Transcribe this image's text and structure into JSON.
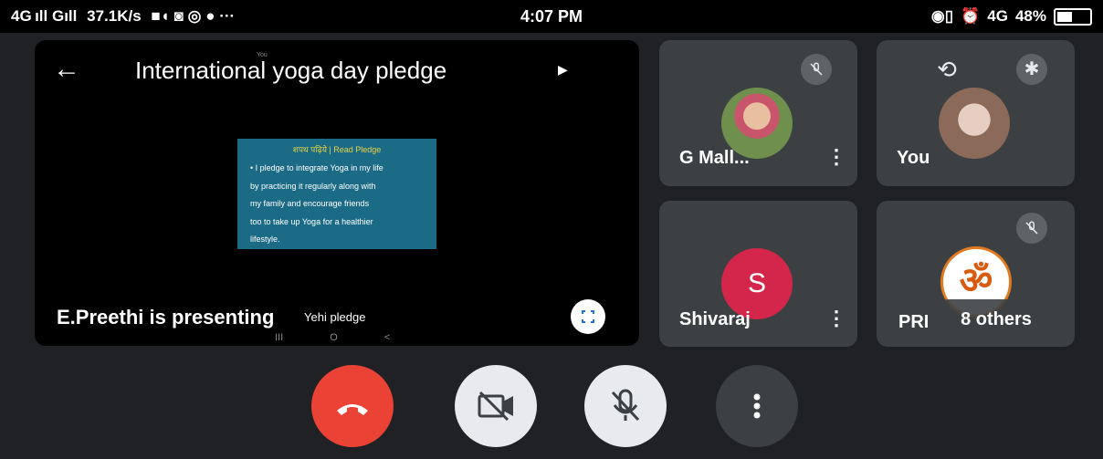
{
  "status_bar": {
    "signal": "4G ıll Gıll",
    "speed": "37.1K/s",
    "time": "4:07 PM",
    "network_right": "4G",
    "battery": "48%"
  },
  "presentation": {
    "title": "International yoga day pledge",
    "screen_you_label": "You",
    "slide_heading": "शपथ पढ़िये | Read Pledge",
    "slide_lines": [
      "• I pledge to integrate Yoga in my life",
      "by practicing it regularly along with",
      "my family and encourage friends",
      "too to take up Yoga for a healthier",
      "lifestyle."
    ],
    "presenter_text": "E.Preethi is presenting",
    "presenter_sub": "Yehi pledge",
    "nav_icons": "III O <"
  },
  "participants": [
    {
      "name": "G Mall..."
    },
    {
      "name": "You"
    },
    {
      "name": "Shivaraj",
      "initial": "S"
    },
    {
      "name": "PRI",
      "overlay": "8 others"
    }
  ],
  "icons": {
    "back": "back-arrow-icon",
    "mic_off": "mic-off-icon",
    "camera_switch": "camera-switch-icon",
    "bluetooth": "bluetooth-icon",
    "end_call": "end-call-icon",
    "camera_off": "camera-off-icon",
    "more": "more-vert-icon",
    "fullscreen": "fullscreen-icon"
  },
  "colors": {
    "end_call": "#ea4335",
    "avatar_s": "#d3264a",
    "slide_bg": "#1b6b86",
    "tile_bg": "#3c4043"
  }
}
